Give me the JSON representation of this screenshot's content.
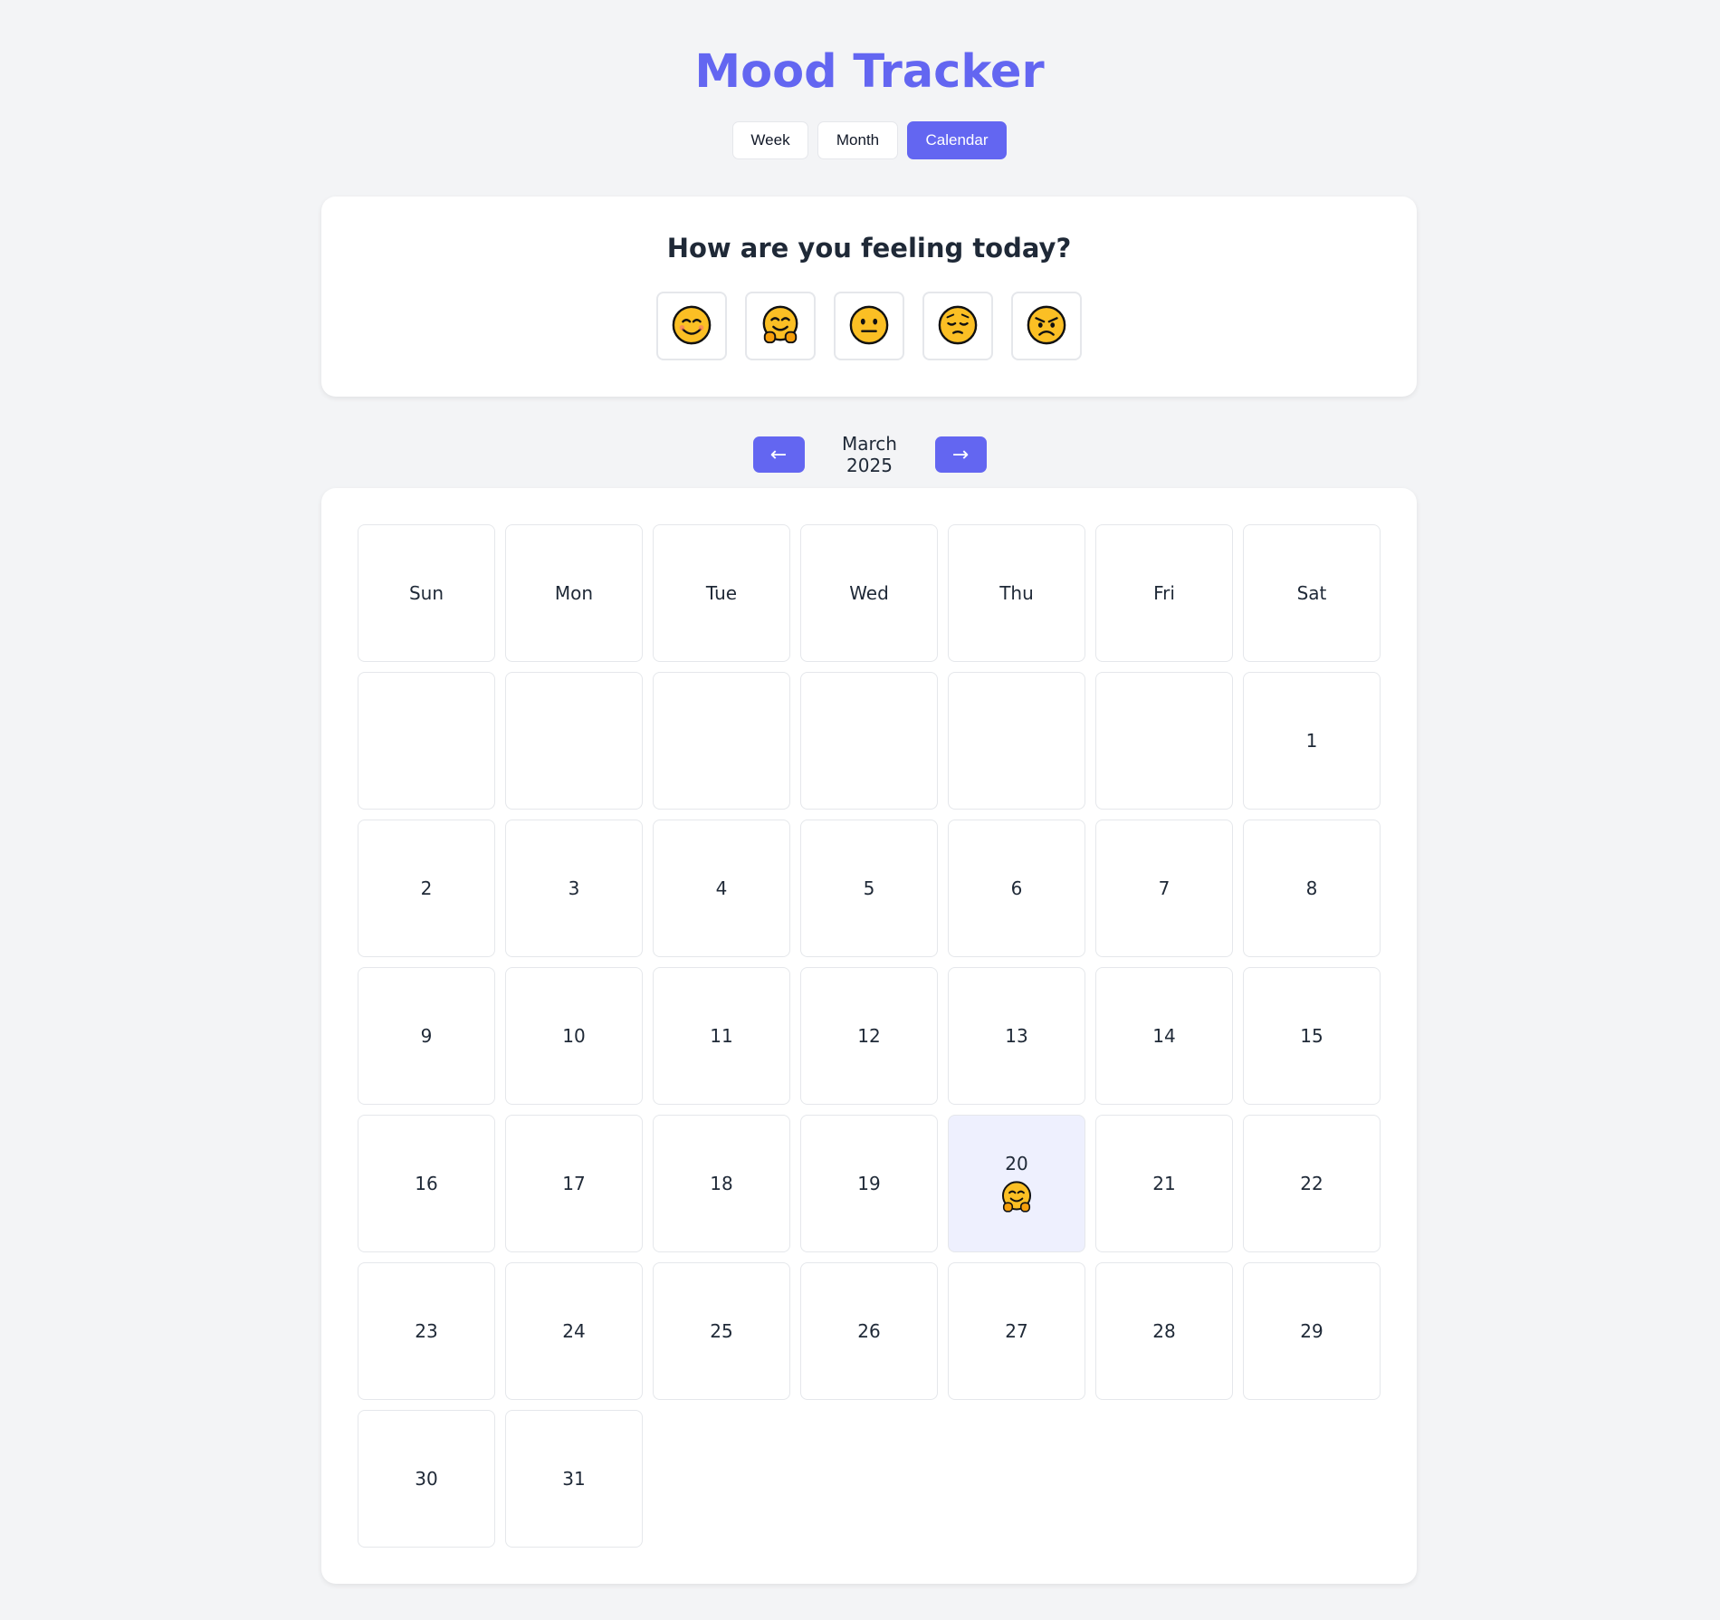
{
  "app": {
    "title": "Mood Tracker"
  },
  "view_tabs": [
    {
      "label": "Week",
      "active": false
    },
    {
      "label": "Month",
      "active": false
    },
    {
      "label": "Calendar",
      "active": true
    }
  ],
  "mood_card": {
    "question": "How are you feeling today?",
    "options": [
      {
        "icon": "smiling-face-icon"
      },
      {
        "icon": "hugging-face-icon"
      },
      {
        "icon": "neutral-face-icon"
      },
      {
        "icon": "pensive-face-icon"
      },
      {
        "icon": "angry-face-icon"
      }
    ]
  },
  "month_nav": {
    "prev_label": "←",
    "next_label": "→",
    "month": "March 2025"
  },
  "calendar": {
    "weekdays": [
      "Sun",
      "Mon",
      "Tue",
      "Wed",
      "Thu",
      "Fri",
      "Sat"
    ],
    "leading_blanks": 6,
    "days": [
      "1",
      "2",
      "3",
      "4",
      "5",
      "6",
      "7",
      "8",
      "9",
      "10",
      "11",
      "12",
      "13",
      "14",
      "15",
      "16",
      "17",
      "18",
      "19",
      "20",
      "21",
      "22",
      "23",
      "24",
      "25",
      "26",
      "27",
      "28",
      "29",
      "30",
      "31"
    ],
    "moods": {
      "20": "hugging-face-icon"
    }
  },
  "colors": {
    "accent": "#6366f1",
    "background": "#f3f4f6",
    "highlight": "#eef0fe",
    "emoji_fill": "#fbbf24"
  }
}
